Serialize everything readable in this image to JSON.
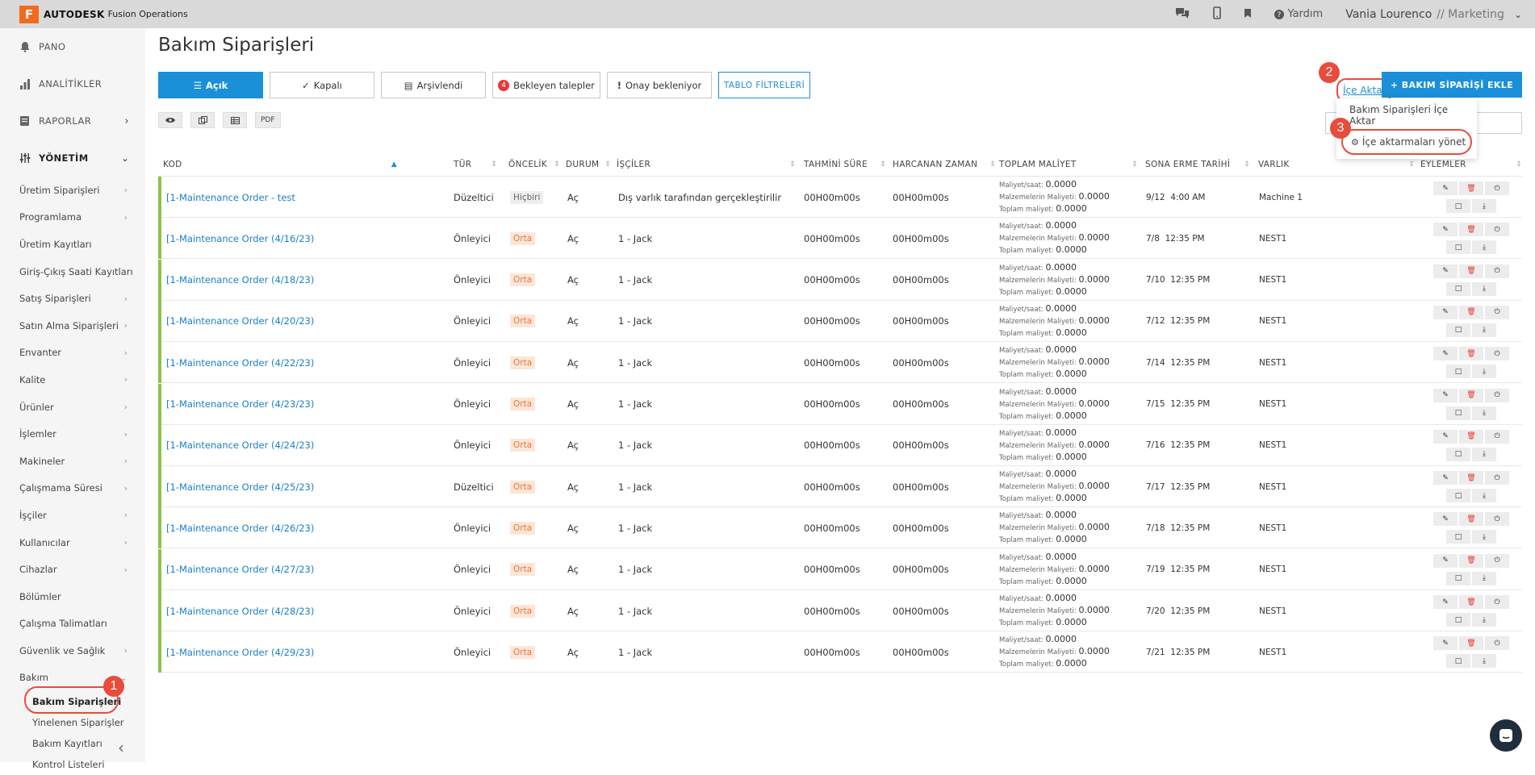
{
  "topbar": {
    "logo_letter": "F",
    "brand": "AUTODESK",
    "product": "Fusion Operations",
    "help": "Yardım",
    "user_name": "Vania Lourenco",
    "user_role": "// Marketing",
    "icons": [
      "chat-icon",
      "mobile-icon",
      "bookmark-icon",
      "help-icon",
      "chevron-down-icon"
    ]
  },
  "sidebar": {
    "main": [
      {
        "label": "PANO",
        "icon": "bell-icon"
      },
      {
        "label": "ANALİTİKLER",
        "icon": "bar-chart-icon"
      },
      {
        "label": "RAPORLAR",
        "icon": "report-icon"
      },
      {
        "label": "YÖNETİM",
        "icon": "sliders-icon"
      }
    ],
    "items": [
      "Üretim Siparişleri",
      "Programlama",
      "Üretim Kayıtları",
      "Giriş-Çıkış Saati Kayıtları",
      "Satış Siparişleri",
      "Satın Alma Siparişleri",
      "Envanter",
      "Kalite",
      "Ürünler",
      "İşlemler",
      "Makineler",
      "Çalışmama Süresi",
      "İşçiler",
      "Kullanıcılar",
      "Cihazlar",
      "Bölümler",
      "Çalışma Talimatları",
      "Güvenlik ve Sağlık",
      "Bakım"
    ],
    "sub": [
      "Bakım Siparişleri",
      "Yinelenen Siparişler",
      "Bakım Kayıtları",
      "Kontrol Listeleri"
    ]
  },
  "page": {
    "title": "Bakım Siparişleri",
    "filters": {
      "open": "Açık",
      "closed": "Kapalı",
      "archived": "Arşivlendi",
      "pending_count": "4",
      "pending": "Bekleyen talepler",
      "awaiting": "Onay bekleniyor",
      "table_filters": "TABLO FİLTRELERİ"
    },
    "tools": {
      "pdf": "PDF"
    },
    "import_link": "İçe Aktar",
    "add_button": "+ BAKIM SİPARİŞİ EKLE",
    "dropdown": {
      "item1": "Bakım Siparişleri İçe Aktar",
      "item2": "İçe aktarmaları yönet"
    },
    "markers": [
      "1",
      "2",
      "3"
    ]
  },
  "table": {
    "headers": {
      "kod": "KOD",
      "tur": "TÜR",
      "oncelik": "ÖNCELİK",
      "durum": "DURUM",
      "isciler": "İŞÇİLER",
      "tahmini": "TAHMİNİ SÜRE",
      "harcanan": "HARCANAN ZAMAN",
      "toplam": "TOPLAM MALİYET",
      "sona": "SONA ERME TARİHİ",
      "varlik": "VARLIK",
      "eylemler": "EYLEMLER"
    },
    "cost_labels": {
      "hourly": "Maliyet/saat:",
      "materials": "Malzemelerin Maliyeti:",
      "total": "Toplam maliyet:"
    },
    "rows": [
      {
        "code": "[1-Maintenance Order - test",
        "type": "Düzeltici",
        "priority": "Hiçbiri",
        "status": "Aç",
        "workers": "Dış varlık tarafından gerçekleştirilir",
        "est": "00H00m00s",
        "spent": "00H00m00s",
        "c1": "0.0000",
        "c2": "0.0000",
        "c3": "0.0000",
        "due_date": "9/12",
        "due_time": "4:00 AM",
        "asset": "Machine 1"
      },
      {
        "code": "[1-Maintenance Order (4/16/23)",
        "type": "Önleyici",
        "priority": "Orta",
        "status": "Aç",
        "workers": "1 - Jack",
        "est": "00H00m00s",
        "spent": "00H00m00s",
        "c1": "0.0000",
        "c2": "0.0000",
        "c3": "0.0000",
        "due_date": "7/8",
        "due_time": "12:35 PM",
        "asset": "NEST1"
      },
      {
        "code": "[1-Maintenance Order (4/18/23)",
        "type": "Önleyici",
        "priority": "Orta",
        "status": "Aç",
        "workers": "1 - Jack",
        "est": "00H00m00s",
        "spent": "00H00m00s",
        "c1": "0.0000",
        "c2": "0.0000",
        "c3": "0.0000",
        "due_date": "7/10",
        "due_time": "12:35 PM",
        "asset": "NEST1"
      },
      {
        "code": "[1-Maintenance Order (4/20/23)",
        "type": "Önleyici",
        "priority": "Orta",
        "status": "Aç",
        "workers": "1 - Jack",
        "est": "00H00m00s",
        "spent": "00H00m00s",
        "c1": "0.0000",
        "c2": "0.0000",
        "c3": "0.0000",
        "due_date": "7/12",
        "due_time": "12:35 PM",
        "asset": "NEST1"
      },
      {
        "code": "[1-Maintenance Order (4/22/23)",
        "type": "Önleyici",
        "priority": "Orta",
        "status": "Aç",
        "workers": "1 - Jack",
        "est": "00H00m00s",
        "spent": "00H00m00s",
        "c1": "0.0000",
        "c2": "0.0000",
        "c3": "0.0000",
        "due_date": "7/14",
        "due_time": "12:35 PM",
        "asset": "NEST1"
      },
      {
        "code": "[1-Maintenance Order (4/23/23)",
        "type": "Önleyici",
        "priority": "Orta",
        "status": "Aç",
        "workers": "1 - Jack",
        "est": "00H00m00s",
        "spent": "00H00m00s",
        "c1": "0.0000",
        "c2": "0.0000",
        "c3": "0.0000",
        "due_date": "7/15",
        "due_time": "12:35 PM",
        "asset": "NEST1"
      },
      {
        "code": "[1-Maintenance Order (4/24/23)",
        "type": "Önleyici",
        "priority": "Orta",
        "status": "Aç",
        "workers": "1 - Jack",
        "est": "00H00m00s",
        "spent": "00H00m00s",
        "c1": "0.0000",
        "c2": "0.0000",
        "c3": "0.0000",
        "due_date": "7/16",
        "due_time": "12:35 PM",
        "asset": "NEST1"
      },
      {
        "code": "[1-Maintenance Order (4/25/23)",
        "type": "Düzeltici",
        "priority": "Orta",
        "status": "Aç",
        "workers": "1 - Jack",
        "est": "00H00m00s",
        "spent": "00H00m00s",
        "c1": "0.0000",
        "c2": "0.0000",
        "c3": "0.0000",
        "due_date": "7/17",
        "due_time": "12:35 PM",
        "asset": "NEST1"
      },
      {
        "code": "[1-Maintenance Order (4/26/23)",
        "type": "Önleyici",
        "priority": "Orta",
        "status": "Aç",
        "workers": "1 - Jack",
        "est": "00H00m00s",
        "spent": "00H00m00s",
        "c1": "0.0000",
        "c2": "0.0000",
        "c3": "0.0000",
        "due_date": "7/18",
        "due_time": "12:35 PM",
        "asset": "NEST1"
      },
      {
        "code": "[1-Maintenance Order (4/27/23)",
        "type": "Önleyici",
        "priority": "Orta",
        "status": "Aç",
        "workers": "1 - Jack",
        "est": "00H00m00s",
        "spent": "00H00m00s",
        "c1": "0.0000",
        "c2": "0.0000",
        "c3": "0.0000",
        "due_date": "7/19",
        "due_time": "12:35 PM",
        "asset": "NEST1"
      },
      {
        "code": "[1-Maintenance Order (4/28/23)",
        "type": "Önleyici",
        "priority": "Orta",
        "status": "Aç",
        "workers": "1 - Jack",
        "est": "00H00m00s",
        "spent": "00H00m00s",
        "c1": "0.0000",
        "c2": "0.0000",
        "c3": "0.0000",
        "due_date": "7/20",
        "due_time": "12:35 PM",
        "asset": "NEST1"
      },
      {
        "code": "[1-Maintenance Order (4/29/23)",
        "type": "Önleyici",
        "priority": "Orta",
        "status": "Aç",
        "workers": "1 - Jack",
        "est": "00H00m00s",
        "spent": "00H00m00s",
        "c1": "0.0000",
        "c2": "0.0000",
        "c3": "0.0000",
        "due_date": "7/21",
        "due_time": "12:35 PM",
        "asset": "NEST1"
      }
    ]
  },
  "colors": {
    "accent": "#1b8fd7",
    "row_bar": "#8bc34a",
    "marker": "#e74c3c",
    "priority_mid": "#e8773a"
  }
}
